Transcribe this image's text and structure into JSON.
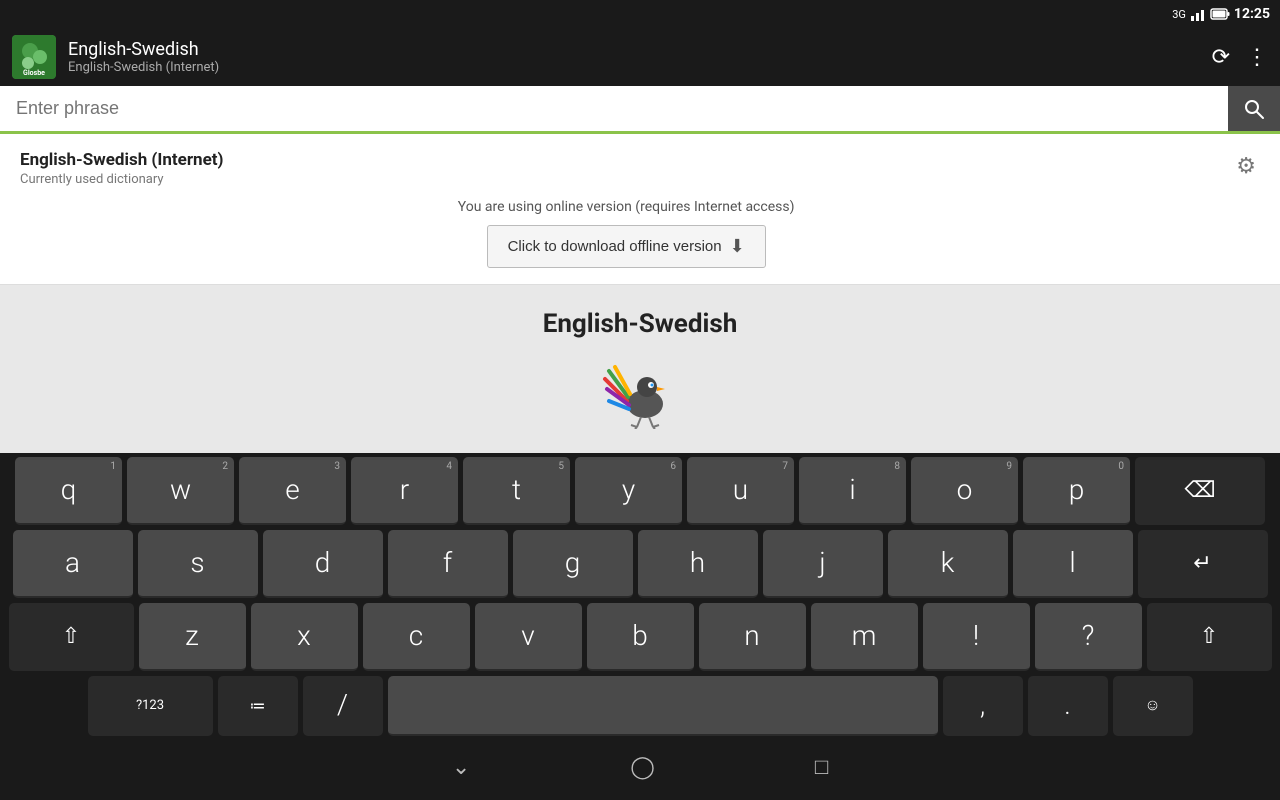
{
  "statusBar": {
    "signal": "3G",
    "battery": "🔋",
    "time": "12:25"
  },
  "appBar": {
    "title": "English-Swedish",
    "subtitle": "English-Swedish (Internet)",
    "iconAlt": "Glosbe",
    "iconLabel": "Eng\nSwe\nGlosbe",
    "refreshLabel": "⟳",
    "menuLabel": "⋮"
  },
  "searchBar": {
    "placeholder": "Enter phrase",
    "searchIconLabel": "🔍"
  },
  "dictCard": {
    "name": "English-Swedish (Internet)",
    "desc": "Currently used dictionary",
    "onlineNotice": "You are using online version (requires Internet access)",
    "downloadBtn": "Click to download offline version",
    "downloadIcon": "⬇",
    "gearIcon": "⚙"
  },
  "mainContent": {
    "title": "English-Swedish"
  },
  "keyboard": {
    "row1": [
      {
        "letter": "q",
        "number": "1"
      },
      {
        "letter": "w",
        "number": "2"
      },
      {
        "letter": "e",
        "number": "3"
      },
      {
        "letter": "r",
        "number": "4"
      },
      {
        "letter": "t",
        "number": "5"
      },
      {
        "letter": "y",
        "number": "6"
      },
      {
        "letter": "u",
        "number": "7"
      },
      {
        "letter": "i",
        "number": "8"
      },
      {
        "letter": "o",
        "number": "9"
      },
      {
        "letter": "p",
        "number": "0"
      }
    ],
    "row2": [
      {
        "letter": "a"
      },
      {
        "letter": "s"
      },
      {
        "letter": "d"
      },
      {
        "letter": "f"
      },
      {
        "letter": "g"
      },
      {
        "letter": "h"
      },
      {
        "letter": "j"
      },
      {
        "letter": "k"
      },
      {
        "letter": "l"
      }
    ],
    "row3": [
      {
        "letter": "z"
      },
      {
        "letter": "x"
      },
      {
        "letter": "c"
      },
      {
        "letter": "v"
      },
      {
        "letter": "b"
      },
      {
        "letter": "n"
      },
      {
        "letter": "m"
      },
      {
        "letter": "!"
      },
      {
        "letter": "?"
      }
    ],
    "row4": {
      "num": "?123",
      "settings": "≔",
      "slash": "/",
      "space": "",
      "comma": ",",
      "period": ".",
      "emoji": "☺"
    }
  },
  "bottomNav": {
    "back": "〱",
    "home": "⌂",
    "recents": "▣"
  }
}
